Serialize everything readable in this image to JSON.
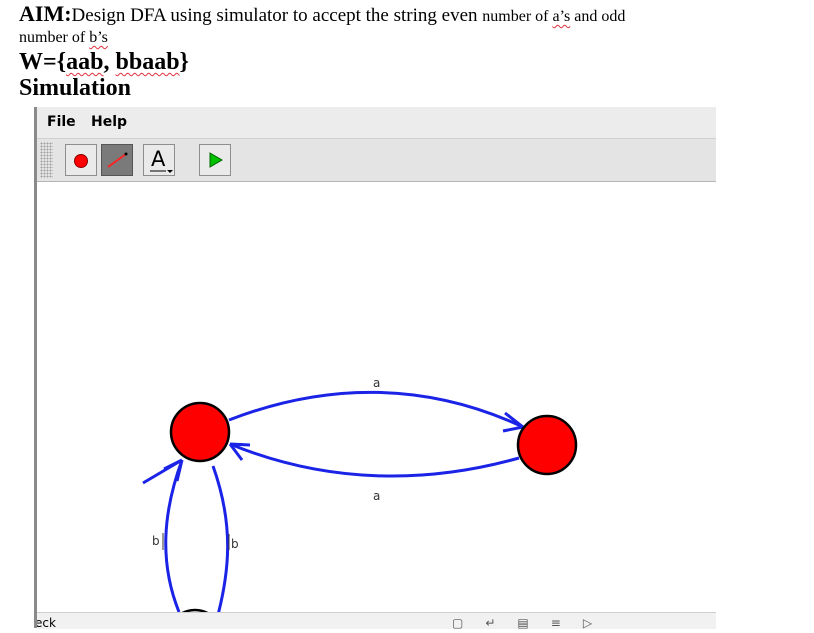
{
  "document": {
    "aim_label": "AIM:",
    "aim_text_part1": "Design DFA using simulator to accept the string even ",
    "aim_text_part2": "number of ",
    "aim_squiggle1": "a’s",
    "aim_text_part3": " and odd",
    "aim_line2_prefix": "number of ",
    "aim_squiggle2": "b’s",
    "w_prefix": "W={",
    "w_squiggle1": "aab",
    "w_sep": ", ",
    "w_squiggle2": "bbaab",
    "w_suffix": "}",
    "simulation_heading": "Simulation"
  },
  "app": {
    "menu": {
      "file": "File",
      "help": "Help"
    },
    "toolbar": {
      "tools": [
        "add-state-tool",
        "add-transition-tool",
        "text-tool",
        "run-tool"
      ],
      "text_tool_glyph": "A",
      "active_tool": "add-transition-tool"
    },
    "colors": {
      "state_fill": "#ff0000",
      "accept_fill": "#00e600",
      "transition": "#1a23e6",
      "play": "#00c000"
    },
    "automaton": {
      "states": [
        {
          "id": "q0",
          "accepting": false
        },
        {
          "id": "q1",
          "accepting": false
        },
        {
          "id": "q2",
          "accepting": true
        }
      ],
      "transitions": [
        {
          "from": "q0",
          "to": "q1",
          "label": "a"
        },
        {
          "from": "q1",
          "to": "q0",
          "label": "a"
        },
        {
          "from": "q2",
          "to": "q0",
          "label": "b"
        },
        {
          "from": "q0",
          "to": "q2",
          "label": "b"
        }
      ]
    },
    "status_text": "Check"
  }
}
